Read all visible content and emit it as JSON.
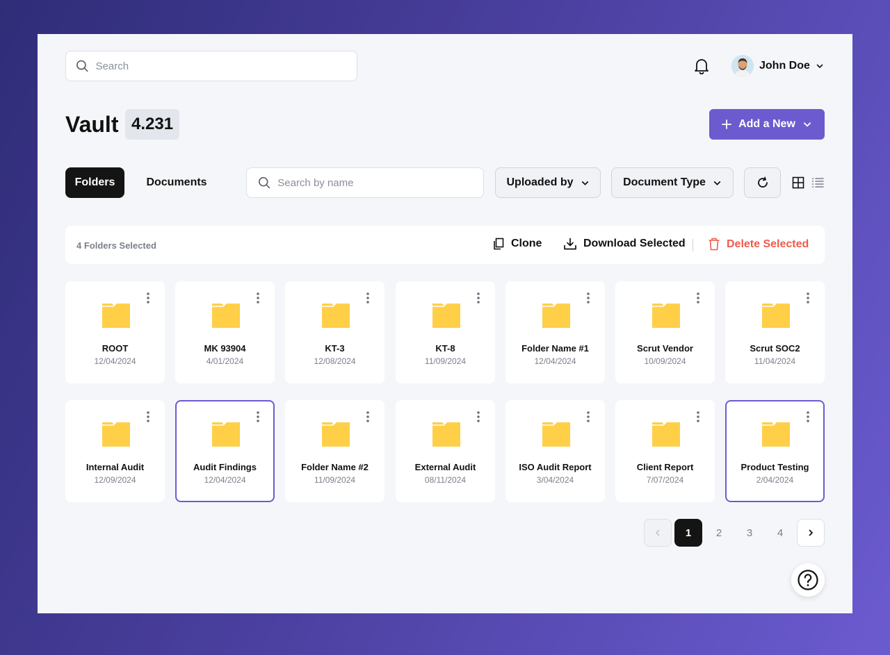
{
  "header": {
    "search_placeholder": "Search",
    "user_name": "John Doe"
  },
  "title": {
    "text": "Vault",
    "count": "4.231",
    "add_button": "Add a New"
  },
  "filters": {
    "tabs": [
      "Folders",
      "Documents"
    ],
    "active_tab": "Folders",
    "name_search_placeholder": "Search by name",
    "uploaded_by": "Uploaded by",
    "document_type": "Document Type"
  },
  "selection": {
    "count_label": "4 Folders Selected",
    "clone": "Clone",
    "download": "Download Selected",
    "delete": "Delete Selected"
  },
  "folders": [
    {
      "name": "ROOT",
      "date": "12/04/2024",
      "selected": false
    },
    {
      "name": "MK 93904",
      "date": "4/01/2024",
      "selected": false
    },
    {
      "name": "KT-3",
      "date": "12/08/2024",
      "selected": false
    },
    {
      "name": "KT-8",
      "date": "11/09/2024",
      "selected": false
    },
    {
      "name": "Folder Name #1",
      "date": "12/04/2024",
      "selected": false
    },
    {
      "name": "Scrut Vendor",
      "date": "10/09/2024",
      "selected": false
    },
    {
      "name": "Scrut SOC2",
      "date": "11/04/2024",
      "selected": false
    },
    {
      "name": "Internal Audit",
      "date": "12/09/2024",
      "selected": false
    },
    {
      "name": "Audit Findings",
      "date": "12/04/2024",
      "selected": true
    },
    {
      "name": "Folder Name #2",
      "date": "11/09/2024",
      "selected": false
    },
    {
      "name": "External Audit",
      "date": "08/11/2024",
      "selected": false
    },
    {
      "name": "ISO Audit Report",
      "date": "3/04/2024",
      "selected": false
    },
    {
      "name": "Client Report",
      "date": "7/07/2024",
      "selected": false
    },
    {
      "name": "Product Testing",
      "date": "2/04/2024",
      "selected": true
    }
  ],
  "pagination": {
    "pages": [
      "1",
      "2",
      "3",
      "4"
    ],
    "current": "1"
  },
  "colors": {
    "accent": "#6c5bcf",
    "danger": "#ef5a4b",
    "folder": "#ffcf48"
  },
  "icons": {
    "search": "search-icon",
    "bell": "bell-icon",
    "chevron": "chevron-down-icon",
    "plus": "plus-icon",
    "refresh": "refresh-icon",
    "grid": "grid-view-icon",
    "list": "list-view-icon",
    "clone": "clone-icon",
    "download": "download-icon",
    "trash": "trash-icon",
    "folder": "folder-icon",
    "kebab": "kebab-menu-icon",
    "help": "help-icon"
  }
}
